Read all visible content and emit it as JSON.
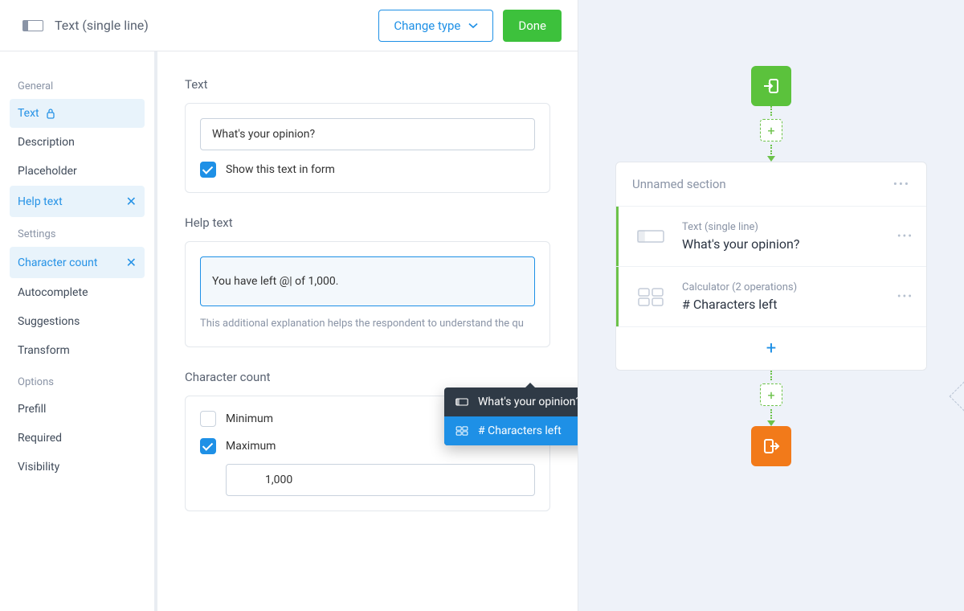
{
  "topbar": {
    "title": "Text (single line)",
    "change_label": "Change type",
    "done_label": "Done"
  },
  "sidebar": {
    "sections": [
      {
        "head": "General",
        "items": [
          {
            "label": "Text",
            "active": true,
            "locked": true
          },
          {
            "label": "Description"
          },
          {
            "label": "Placeholder"
          },
          {
            "label": "Help text",
            "active": true,
            "close": true
          }
        ]
      },
      {
        "head": "Settings",
        "items": [
          {
            "label": "Character count",
            "active": true,
            "close": true
          },
          {
            "label": "Autocomplete"
          },
          {
            "label": "Suggestions"
          },
          {
            "label": "Transform"
          }
        ]
      },
      {
        "head": "Options",
        "items": [
          {
            "label": "Prefill"
          },
          {
            "label": "Required"
          },
          {
            "label": "Visibility"
          }
        ]
      }
    ]
  },
  "content": {
    "text_section": "Text",
    "text_value": "What's your opinion?",
    "show_in_form": "Show this text in form",
    "help_section": "Help text",
    "help_value": "You have left @| of 1,000.",
    "help_hint": "This additional explanation helps the respondent to understand the qu",
    "count_section": "Character count",
    "minimum": "Minimum",
    "maximum": "Maximum",
    "maximum_value": "1,000"
  },
  "popup": {
    "items": [
      {
        "label": "What's your opinion?"
      },
      {
        "label": "# Characters left",
        "selected": true
      }
    ]
  },
  "flow": {
    "section_title": "Unnamed section",
    "rows": [
      {
        "type": "Text (single line)",
        "title": "What's your opinion?"
      },
      {
        "type": "Calculator (2 operations)",
        "title": "# Characters left"
      }
    ]
  }
}
